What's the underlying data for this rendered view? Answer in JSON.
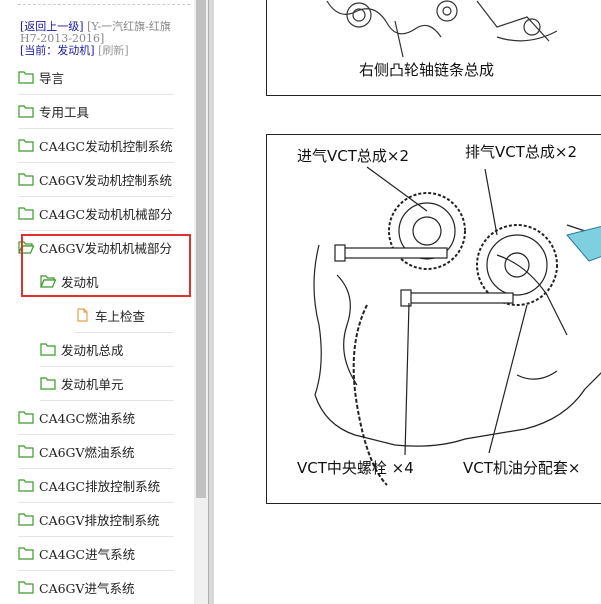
{
  "breadcrumb": {
    "back_label": "[返回上一级]",
    "book_title": "[Y-一汽红旗-红旗H7-2013-2016]",
    "current_label": "[当前：发动机]",
    "refresh_label": "[刷新]"
  },
  "nav_items": [
    {
      "label": "导言",
      "icon": "folder-icon"
    },
    {
      "label": "专用工具",
      "icon": "folder-icon"
    },
    {
      "label": "CA4GC发动机控制系统",
      "icon": "folder-icon"
    },
    {
      "label": "CA6GV发动机控制系统",
      "icon": "folder-icon"
    },
    {
      "label": "CA4GC发动机机械部分",
      "icon": "folder-icon"
    },
    {
      "label": "CA6GV发动机机械部分",
      "icon": "folder-open-icon"
    },
    {
      "label": "发动机",
      "icon": "folder-open-icon"
    },
    {
      "label": "车上检查",
      "icon": "document-icon"
    },
    {
      "label": "发动机总成",
      "icon": "folder-icon"
    },
    {
      "label": "发动机单元",
      "icon": "folder-icon"
    },
    {
      "label": "CA4GC燃油系统",
      "icon": "folder-icon"
    },
    {
      "label": "CA6GV燃油系统",
      "icon": "folder-icon"
    },
    {
      "label": "CA4GC排放控制系统",
      "icon": "folder-icon"
    },
    {
      "label": "CA6GV排放控制系统",
      "icon": "folder-icon"
    },
    {
      "label": "CA4GC进气系统",
      "icon": "folder-icon"
    },
    {
      "label": "CA6GV进气系统",
      "icon": "folder-icon"
    }
  ],
  "figure1": {
    "caption": "右侧凸轮轴链条总成",
    "code": "EM"
  },
  "figure2": {
    "label_intake": "进气VCT总成×2",
    "label_exhaust": "排气VCT总成×2",
    "label_bolt": "VCT中央螺栓 ×4",
    "label_oil": "VCT机油分配套×",
    "code": "EM"
  },
  "colors": {
    "link": "#1a1aa6",
    "highlight_border": "#e03030",
    "folder_stroke": "#3a9a2a",
    "doc_stroke": "#e2a34a"
  }
}
